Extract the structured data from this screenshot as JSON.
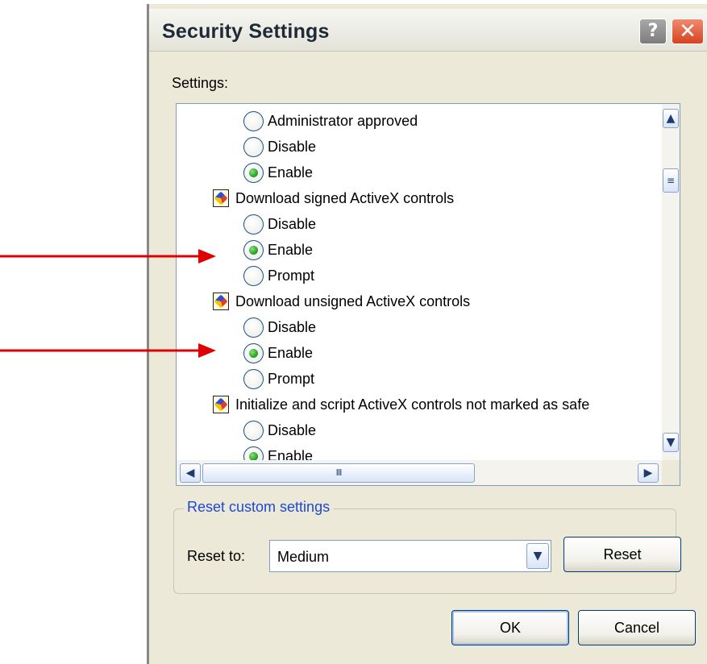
{
  "window": {
    "title": "Security Settings",
    "help_glyph": "?",
    "close_glyph": "✕"
  },
  "settings_label": "Settings:",
  "settings_list": [
    {
      "kind": "option",
      "label": "Administrator approved",
      "checked": false
    },
    {
      "kind": "option",
      "label": "Disable",
      "checked": false
    },
    {
      "kind": "option",
      "label": "Enable",
      "checked": true
    },
    {
      "kind": "category",
      "label": "Download signed ActiveX controls",
      "icon": "settings-category-icon"
    },
    {
      "kind": "option",
      "label": "Disable",
      "checked": false
    },
    {
      "kind": "option",
      "label": "Enable",
      "checked": true
    },
    {
      "kind": "option",
      "label": "Prompt",
      "checked": false
    },
    {
      "kind": "category",
      "label": "Download unsigned ActiveX controls",
      "icon": "settings-category-icon"
    },
    {
      "kind": "option",
      "label": "Disable",
      "checked": false
    },
    {
      "kind": "option",
      "label": "Enable",
      "checked": true
    },
    {
      "kind": "option",
      "label": "Prompt",
      "checked": false
    },
    {
      "kind": "category",
      "label": "Initialize and script ActiveX controls not marked as safe",
      "icon": "settings-category-icon"
    },
    {
      "kind": "option",
      "label": "Disable",
      "checked": false
    },
    {
      "kind": "option",
      "label": "Enable",
      "checked": true
    }
  ],
  "scrollbar": {
    "up_glyph": "▲",
    "down_glyph": "▼",
    "left_glyph": "◀",
    "right_glyph": "▶",
    "v_grip": "≡",
    "h_grip": "III"
  },
  "reset_group": {
    "title": "Reset custom settings",
    "reset_to_label": "Reset to:",
    "combo_value": "Medium",
    "combo_glyph": "▼",
    "reset_button": "Reset"
  },
  "footer": {
    "ok_label": "OK",
    "cancel_label": "Cancel"
  },
  "colors": {
    "arrow": "#e00000",
    "dialog_bg": "#ece9d8",
    "group_title": "#1b49d6"
  },
  "annotations": [
    {
      "type": "arrow",
      "points_to": "Enable (Download signed ActiveX controls)"
    },
    {
      "type": "arrow",
      "points_to": "Enable (Download unsigned ActiveX controls)"
    }
  ]
}
